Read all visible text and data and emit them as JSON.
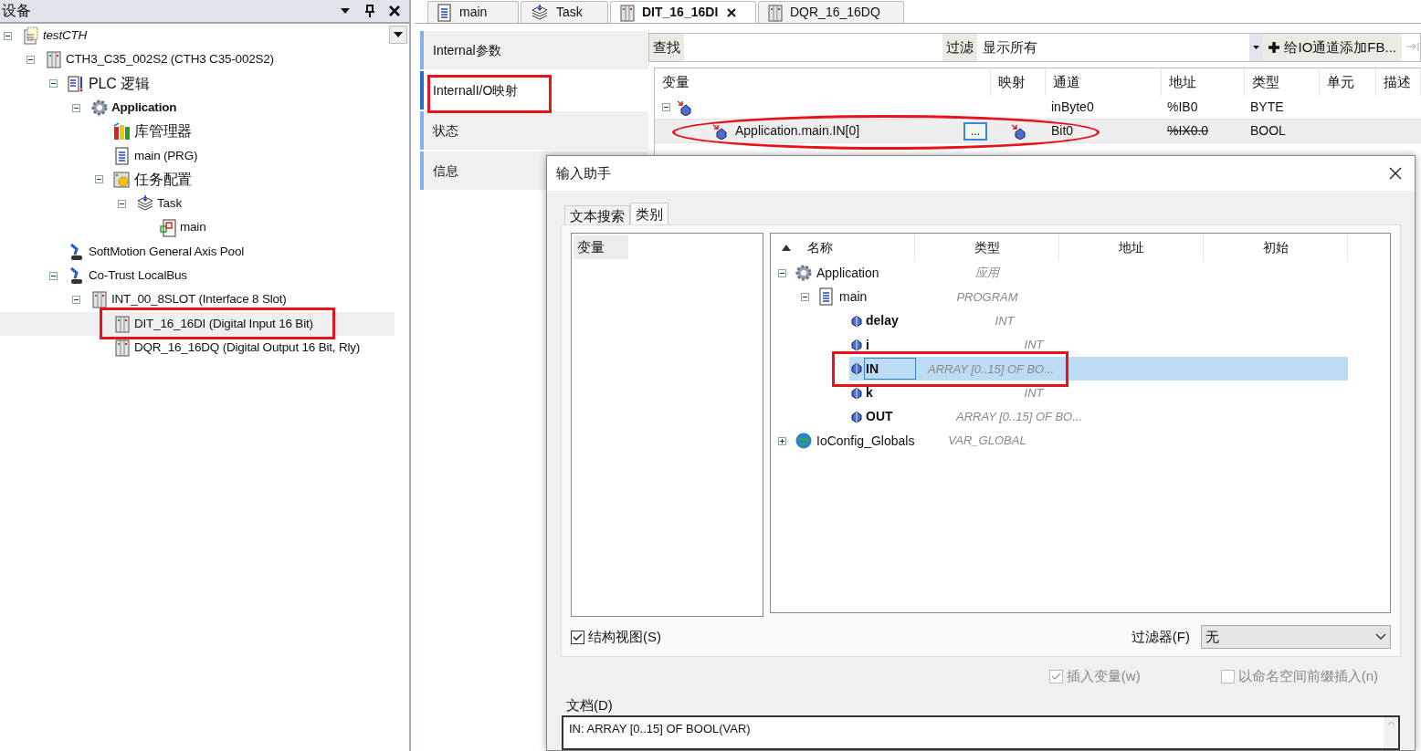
{
  "device_panel": {
    "title": "设备",
    "tree": [
      {
        "label": "testCTH",
        "kind": "project",
        "expanded": true,
        "selected": false,
        "children": [
          {
            "label": "CTH3_C35_002S2 (CTH3 C35-002S2)",
            "kind": "device",
            "expanded": true,
            "selected": false,
            "children": [
              {
                "label": "PLC 逻辑",
                "kind": "plc",
                "expanded": true,
                "selected": false,
                "children": [
                  {
                    "label": "Application",
                    "kind": "application",
                    "expanded": true,
                    "selected": false,
                    "children": [
                      {
                        "label": "库管理器",
                        "kind": "library",
                        "selected": false
                      },
                      {
                        "label": "main (PRG)",
                        "kind": "pou",
                        "selected": false
                      },
                      {
                        "label": "任务配置",
                        "kind": "task_config",
                        "expanded": true,
                        "selected": false,
                        "children": [
                          {
                            "label": "Task",
                            "kind": "task",
                            "expanded": true,
                            "selected": false,
                            "children": [
                              {
                                "label": "main",
                                "kind": "task_call",
                                "selected": false
                              }
                            ]
                          }
                        ]
                      }
                    ]
                  }
                ]
              },
              {
                "label": "SoftMotion General Axis Pool",
                "kind": "axis",
                "selected": false
              },
              {
                "label": "Co-Trust LocalBus",
                "kind": "axis",
                "expanded": true,
                "selected": false,
                "children": [
                  {
                    "label": "INT_00_8SLOT (Interface 8 Slot)",
                    "kind": "module",
                    "expanded": true,
                    "selected": false,
                    "children": [
                      {
                        "label": "DIT_16_16DI (Digital Input 16 Bit)",
                        "kind": "module",
                        "selected": true
                      },
                      {
                        "label": "DQR_16_16DQ (Digital Output 16 Bit, Rly)",
                        "kind": "module",
                        "selected": false
                      }
                    ]
                  }
                ]
              }
            ]
          }
        ]
      }
    ]
  },
  "editor_tabs": [
    {
      "label": "main",
      "kind": "pou",
      "selected": false
    },
    {
      "label": "Task",
      "kind": "task",
      "selected": false
    },
    {
      "label": "DIT_16_16DI",
      "kind": "module",
      "selected": true
    },
    {
      "label": "DQR_16_16DQ",
      "kind": "module",
      "selected": false
    }
  ],
  "nav": [
    {
      "label": "Internal参数",
      "selected": false
    },
    {
      "label": "InternalI/O映射",
      "selected": true
    },
    {
      "label": "状态",
      "selected": false
    },
    {
      "label": "信息",
      "selected": false
    }
  ],
  "toolbar": {
    "find_button": "查找",
    "filter_button": "过滤",
    "filter_value": "显示所有",
    "add_fb_button": "给IO通道添加FB..."
  },
  "table": {
    "columns": [
      "变量",
      "映射",
      "通道",
      "地址",
      "类型",
      "单元",
      "描述"
    ],
    "rows": [
      {
        "kind": "byte",
        "expanded": true,
        "channel": "inByte0",
        "address": "%IB0",
        "type": "BYTE",
        "selected": false,
        "struck": false
      },
      {
        "kind": "bit",
        "variable": "Application.main.IN[0]",
        "browse_button": "...",
        "channel": "Bit0",
        "address": "%IX0.0",
        "type": "BOOL",
        "selected": true,
        "struck": true
      }
    ]
  },
  "dialog": {
    "title": "输入助手",
    "tabs": [
      {
        "label": "文本搜索",
        "selected": false
      },
      {
        "label": "类别",
        "selected": true
      }
    ],
    "categories": [
      {
        "label": "变量",
        "selected": true
      }
    ],
    "columns": [
      "名称",
      "类型",
      "地址",
      "初始"
    ],
    "tree": [
      {
        "name": "Application",
        "kind": "application",
        "type": "应用",
        "expanded": true,
        "selected": false,
        "children": [
          {
            "name": "main",
            "kind": "pou",
            "type": "PROGRAM",
            "expanded": true,
            "selected": false,
            "children": [
              {
                "name": "delay",
                "kind": "variable",
                "type": "INT",
                "selected": false
              },
              {
                "name": "i",
                "kind": "variable",
                "type": "INT",
                "selected": false
              },
              {
                "name": "IN",
                "kind": "variable",
                "type": "ARRAY [0..15] OF BO...",
                "selected": true
              },
              {
                "name": "k",
                "kind": "variable",
                "type": "INT",
                "selected": false
              },
              {
                "name": "OUT",
                "kind": "variable",
                "type": "ARRAY [0..15] OF BO...",
                "selected": false
              }
            ]
          }
        ]
      },
      {
        "name": "IoConfig_Globals",
        "kind": "gvl",
        "type": "VAR_GLOBAL",
        "expanded": false,
        "selected": false
      }
    ],
    "structure_view": {
      "label": "结构视图(S)",
      "checked": true
    },
    "filter": {
      "label": "过滤器(F)",
      "value": "无"
    },
    "insert_variable": {
      "label": "插入变量(w)",
      "checked": true,
      "disabled": true
    },
    "namespace_prefix": {
      "label": "以命名空间前缀插入(n)",
      "checked": false,
      "disabled": true
    },
    "doc_label": "文档(D)",
    "doc_text": "IN: ARRAY [0..15] OF BOOL(VAR)"
  }
}
